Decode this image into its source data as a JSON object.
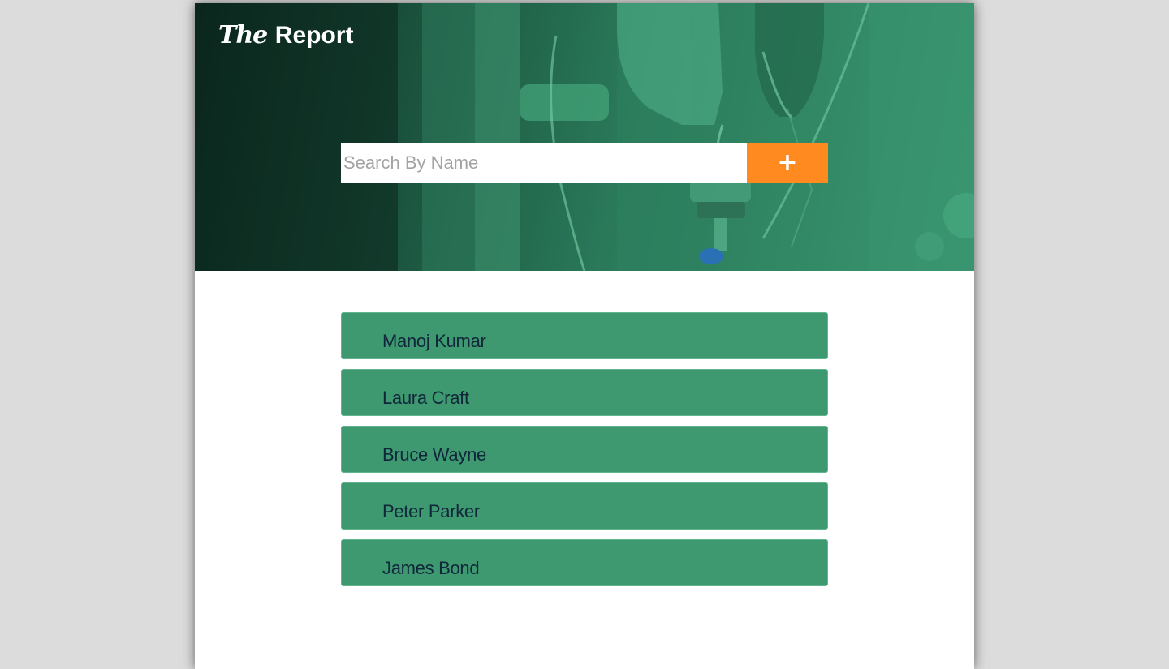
{
  "header": {
    "brand_the": "The",
    "brand_report": "Report"
  },
  "search": {
    "placeholder": "Search By Name",
    "button_icon": "plus-icon",
    "button_glyph": "+",
    "button_color": "#ff8a1f"
  },
  "records": [
    {
      "name": "Manoj Kumar"
    },
    {
      "name": "Laura Craft"
    },
    {
      "name": "Bruce Wayne"
    },
    {
      "name": "Peter Parker"
    },
    {
      "name": "James Bond"
    }
  ],
  "colors": {
    "hero_tint": "#2a7a5a",
    "card": "#3e9970",
    "card_text": "#10263a"
  }
}
